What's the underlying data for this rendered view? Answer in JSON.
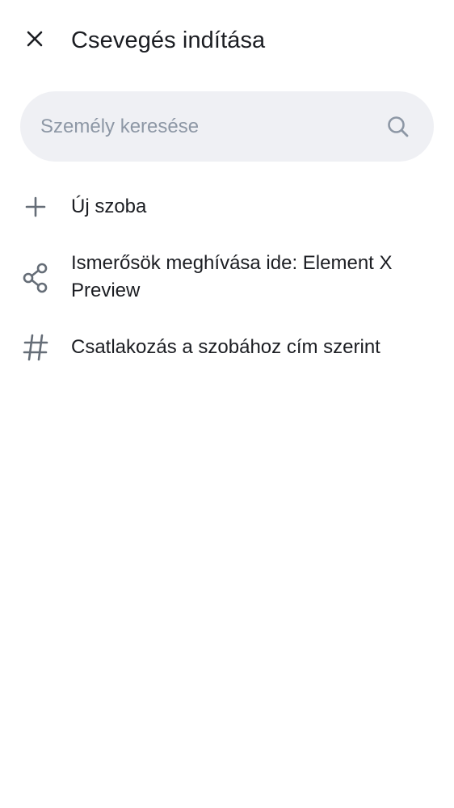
{
  "header": {
    "title": "Csevegés indítása"
  },
  "search": {
    "placeholder": "Személy keresése",
    "value": ""
  },
  "actions": [
    {
      "label": "Új szoba",
      "icon": "plus-icon"
    },
    {
      "label": "Ismerősök meghívása ide: Element X Preview",
      "icon": "share-icon"
    },
    {
      "label": "Csatlakozás a szobához cím szerint",
      "icon": "hash-icon"
    }
  ],
  "colors": {
    "text": "#1b1d22",
    "icon": "#656d77",
    "search_bg": "#eff0f4",
    "placeholder": "#8d97a5"
  }
}
